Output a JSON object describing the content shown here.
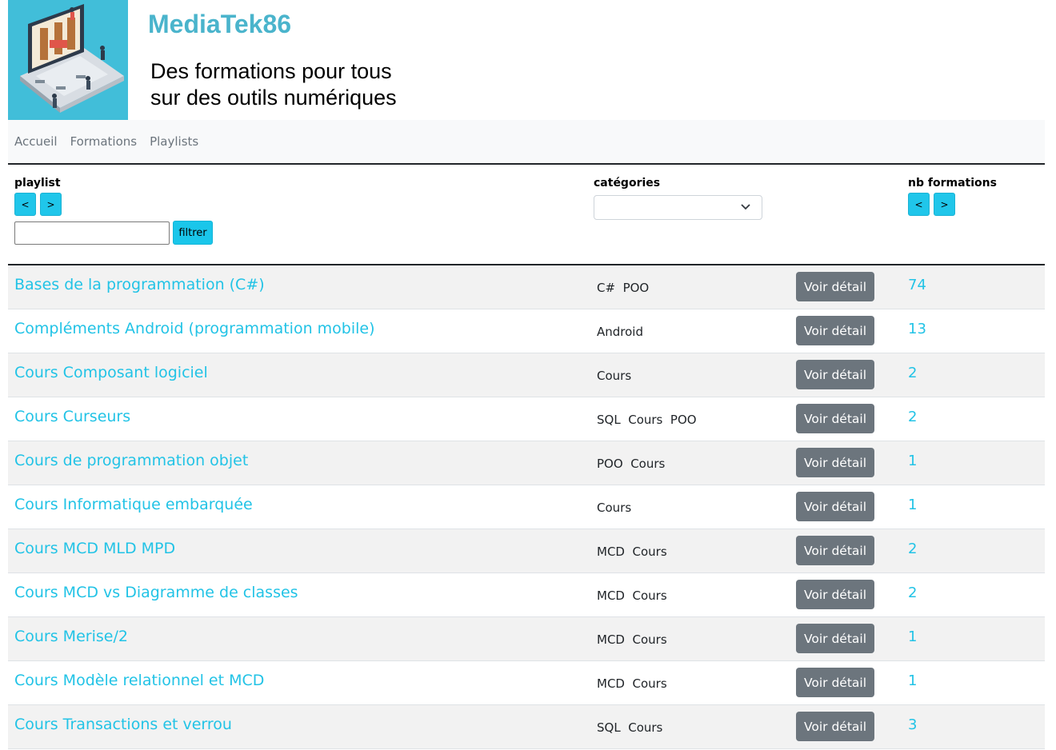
{
  "header": {
    "site_title": "MediaTek86",
    "tagline_line1": "Des formations pour tous",
    "tagline_line2": "sur des outils numériques",
    "logo_icon": "laptop-library-illustration"
  },
  "nav": {
    "items": [
      {
        "label": "Accueil"
      },
      {
        "label": "Formations"
      },
      {
        "label": "Playlists"
      }
    ]
  },
  "table_header": {
    "playlist_label": "playlist",
    "categories_label": "catégories",
    "nb_label": "nb formations",
    "sort_asc": "<",
    "sort_desc": ">",
    "filter_button": "filtrer",
    "filter_value": "",
    "category_selected": ""
  },
  "colors": {
    "accent": "#22c3e6",
    "button_cyan": "#1ac6ea",
    "detail_button": "#6c757d",
    "title": "#4ab4cc",
    "logo_bg": "#41bed9"
  },
  "rows": [
    {
      "name": "Bases de la programmation (C#)",
      "categories": "C#  POO",
      "action": "Voir détail",
      "nb": "74"
    },
    {
      "name": "Compléments Android (programmation mobile)",
      "categories": "Android",
      "action": "Voir détail",
      "nb": "13"
    },
    {
      "name": "Cours Composant logiciel",
      "categories": "Cours",
      "action": "Voir détail",
      "nb": "2"
    },
    {
      "name": "Cours Curseurs",
      "categories": "SQL  Cours  POO",
      "action": "Voir détail",
      "nb": "2"
    },
    {
      "name": "Cours de programmation objet",
      "categories": "POO  Cours",
      "action": "Voir détail",
      "nb": "1"
    },
    {
      "name": "Cours Informatique embarquée",
      "categories": "Cours",
      "action": "Voir détail",
      "nb": "1"
    },
    {
      "name": "Cours MCD MLD MPD",
      "categories": "MCD  Cours",
      "action": "Voir détail",
      "nb": "2"
    },
    {
      "name": "Cours MCD vs Diagramme de classes",
      "categories": "MCD  Cours",
      "action": "Voir détail",
      "nb": "2"
    },
    {
      "name": "Cours Merise/2",
      "categories": "MCD  Cours",
      "action": "Voir détail",
      "nb": "1"
    },
    {
      "name": "Cours Modèle relationnel et MCD",
      "categories": "MCD  Cours",
      "action": "Voir détail",
      "nb": "1"
    },
    {
      "name": "Cours Transactions et verrou",
      "categories": "SQL  Cours",
      "action": "Voir détail",
      "nb": "3"
    }
  ]
}
